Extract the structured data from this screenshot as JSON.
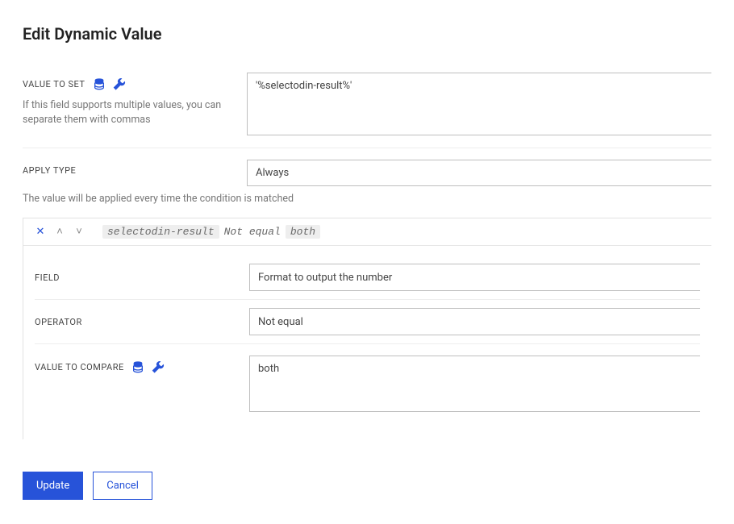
{
  "title": "Edit Dynamic Value",
  "value_to_set": {
    "label": "VALUE TO SET",
    "value": "'%selectodin-result%'",
    "help": "If this field supports multiple values, you can separate them with commas"
  },
  "apply_type": {
    "label": "APPLY TYPE",
    "value": "Always",
    "help": "The value will be applied every time the condition is matched"
  },
  "condition": {
    "summary_field": "selectodin-result",
    "summary_op": "Not equal",
    "summary_value": "both",
    "field": {
      "label": "FIELD",
      "value": "Format to output the number"
    },
    "operator": {
      "label": "OPERATOR",
      "value": "Not equal"
    },
    "compare": {
      "label": "VALUE TO COMPARE",
      "value": "both"
    }
  },
  "buttons": {
    "update": "Update",
    "cancel": "Cancel"
  }
}
